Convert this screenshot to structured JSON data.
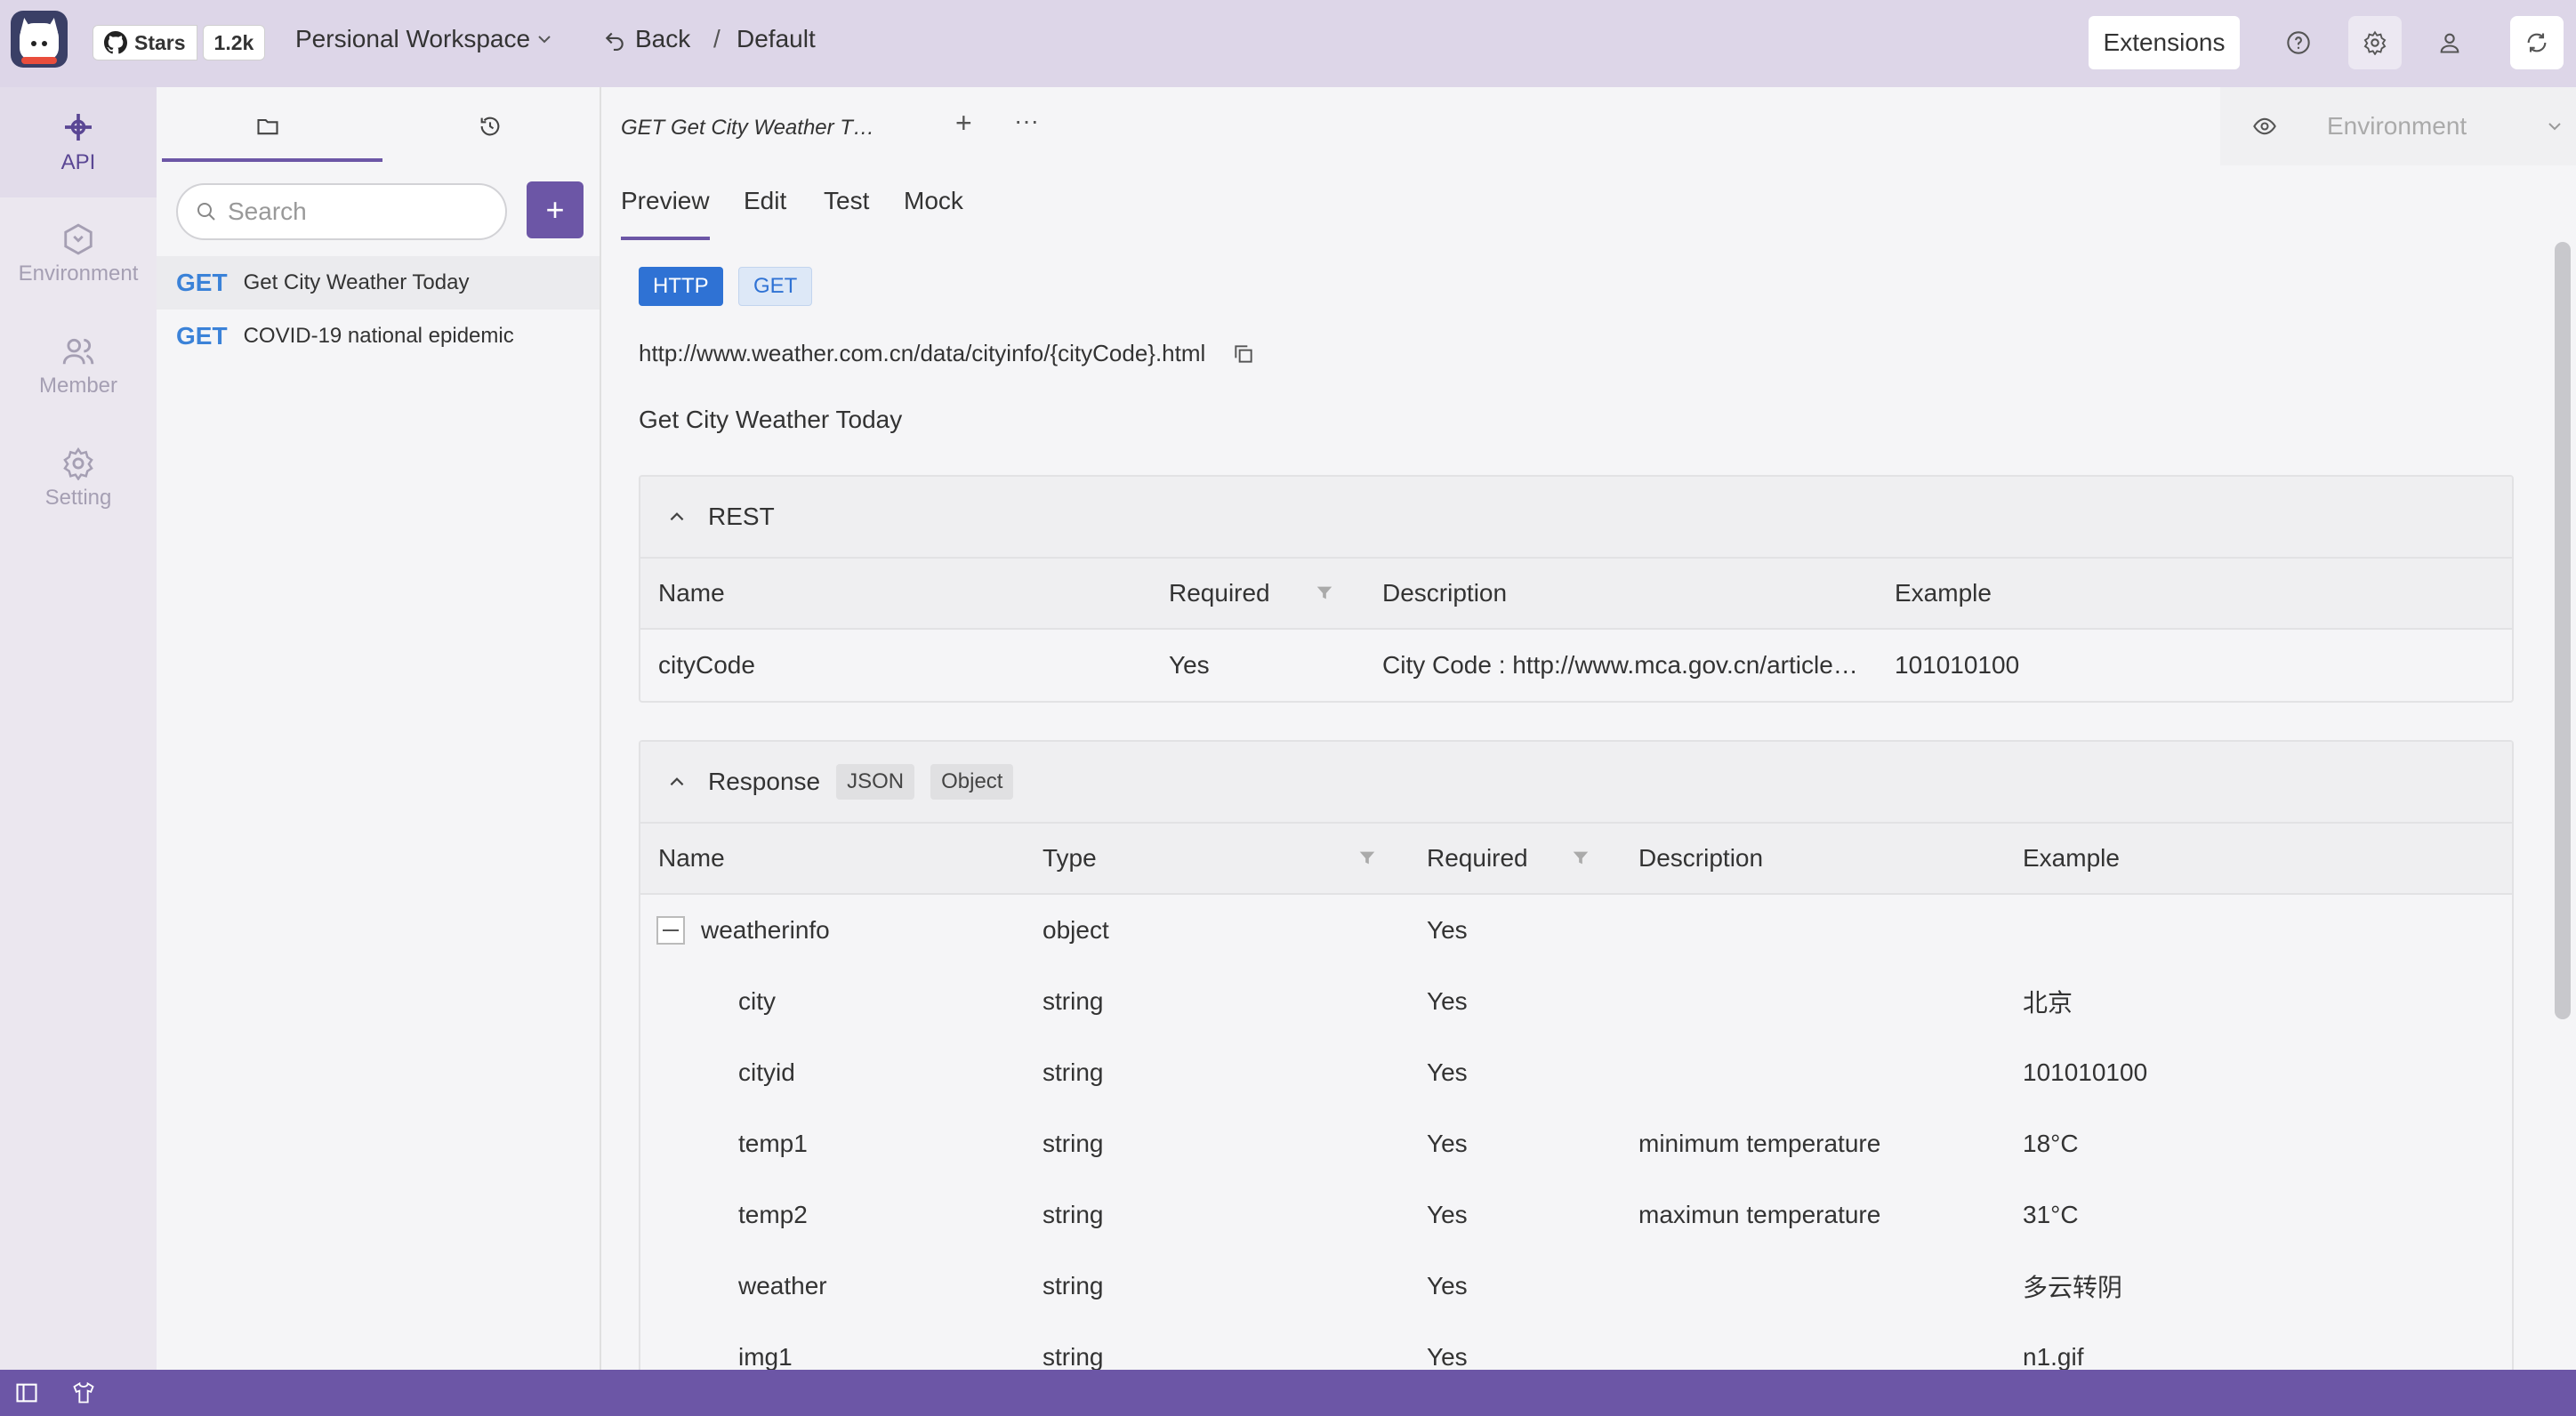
{
  "topbar": {
    "github_stars_label": "Stars",
    "github_stars_count": "1.2k",
    "workspace": "Persional Workspace",
    "back_label": "Back",
    "breadcrumb_sep": "/",
    "breadcrumb_current": "Default",
    "extensions_label": "Extensions"
  },
  "leftnav": {
    "items": [
      {
        "label": "API",
        "icon": "api-icon",
        "active": true
      },
      {
        "label": "Environment",
        "icon": "environment-icon"
      },
      {
        "label": "Member",
        "icon": "member-icon"
      },
      {
        "label": "Setting",
        "icon": "setting-icon"
      }
    ]
  },
  "sidebar": {
    "search_placeholder": "Search",
    "add_label": "+",
    "apis": [
      {
        "method": "GET",
        "name": "Get City Weather Today"
      },
      {
        "method": "GET",
        "name": "COVID-19 national epidemic"
      }
    ]
  },
  "main": {
    "file_tab": "GET  Get City Weather T…",
    "tab_add": "+",
    "tab_more": "···",
    "environment_placeholder": "Environment",
    "subtabs": [
      "Preview",
      "Edit",
      "Test",
      "Mock"
    ],
    "protocol": "HTTP",
    "method": "GET",
    "url": "http://www.weather.com.cn/data/cityinfo/{cityCode}.html",
    "description": "Get City Weather Today"
  },
  "rest": {
    "title": "REST",
    "columns": [
      "Name",
      "Required",
      "Description",
      "Example"
    ],
    "rows": [
      {
        "name": "cityCode",
        "required": "Yes",
        "description": "City Code : http://www.mca.gov.cn/article…",
        "example": "101010100"
      }
    ]
  },
  "response": {
    "title": "Response",
    "format": "JSON",
    "type": "Object",
    "columns": [
      "Name",
      "Type",
      "Required",
      "Description",
      "Example"
    ],
    "rows": [
      {
        "name": "weatherinfo",
        "type": "object",
        "required": "Yes",
        "description": "",
        "example": ""
      },
      {
        "name": "city",
        "type": "string",
        "required": "Yes",
        "description": "",
        "example": "北京"
      },
      {
        "name": "cityid",
        "type": "string",
        "required": "Yes",
        "description": "",
        "example": "101010100"
      },
      {
        "name": "temp1",
        "type": "string",
        "required": "Yes",
        "description": "minimum temperature",
        "example": "18°C"
      },
      {
        "name": "temp2",
        "type": "string",
        "required": "Yes",
        "description": "maximun temperature",
        "example": "31°C"
      },
      {
        "name": "weather",
        "type": "string",
        "required": "Yes",
        "description": "",
        "example": "多云转阴"
      },
      {
        "name": "img1",
        "type": "string",
        "required": "Yes",
        "description": "",
        "example": "n1.gif"
      }
    ]
  },
  "colors": {
    "accent": "#6c56a6",
    "method_get": "#3b82d8",
    "topbar_bg": "#ddd6e8"
  }
}
